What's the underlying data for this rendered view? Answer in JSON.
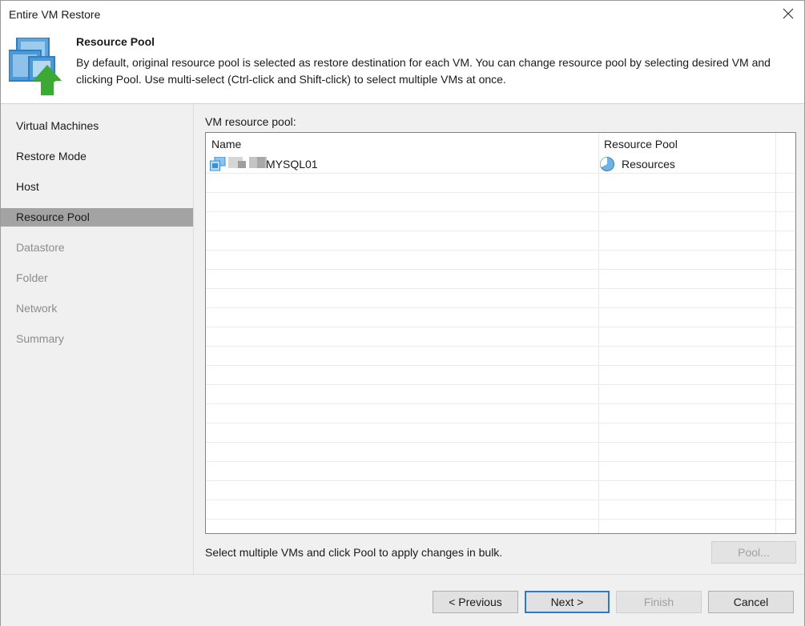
{
  "window": {
    "title": "Entire VM Restore"
  },
  "header": {
    "title": "Resource Pool",
    "description": "By default, original resource pool is selected as restore destination for each VM. You can change resource pool by selecting desired VM and clicking Pool. Use multi-select (Ctrl-click and Shift-click) to select multiple VMs at once.",
    "icon": "vm-restore-icon"
  },
  "sidebar": {
    "items": [
      {
        "label": "Virtual Machines",
        "state": "done"
      },
      {
        "label": "Restore Mode",
        "state": "done"
      },
      {
        "label": "Host",
        "state": "done"
      },
      {
        "label": "Resource Pool",
        "state": "active"
      },
      {
        "label": "Datastore",
        "state": "pending"
      },
      {
        "label": "Folder",
        "state": "pending"
      },
      {
        "label": "Network",
        "state": "pending"
      },
      {
        "label": "Summary",
        "state": "pending"
      }
    ]
  },
  "main": {
    "section_label": "VM resource pool:",
    "table": {
      "columns": [
        "Name",
        "Resource Pool"
      ],
      "rows": [
        {
          "name": "MYSQL01",
          "resource_pool": "Resources",
          "name_icon": "vm-icon",
          "pool_icon": "resource-pool-icon"
        }
      ]
    },
    "hint": "Select multiple VMs and click Pool to apply changes in bulk.",
    "pool_button": "Pool..."
  },
  "footer": {
    "previous": "< Previous",
    "next": "Next >",
    "finish": "Finish",
    "cancel": "Cancel"
  },
  "colors": {
    "active_nav": "#a3a3a3",
    "pending_text": "#8c8c8c",
    "primary_border": "#2a7ad5",
    "icon_blue": "#3b8fd6",
    "icon_green": "#3aaa35"
  }
}
